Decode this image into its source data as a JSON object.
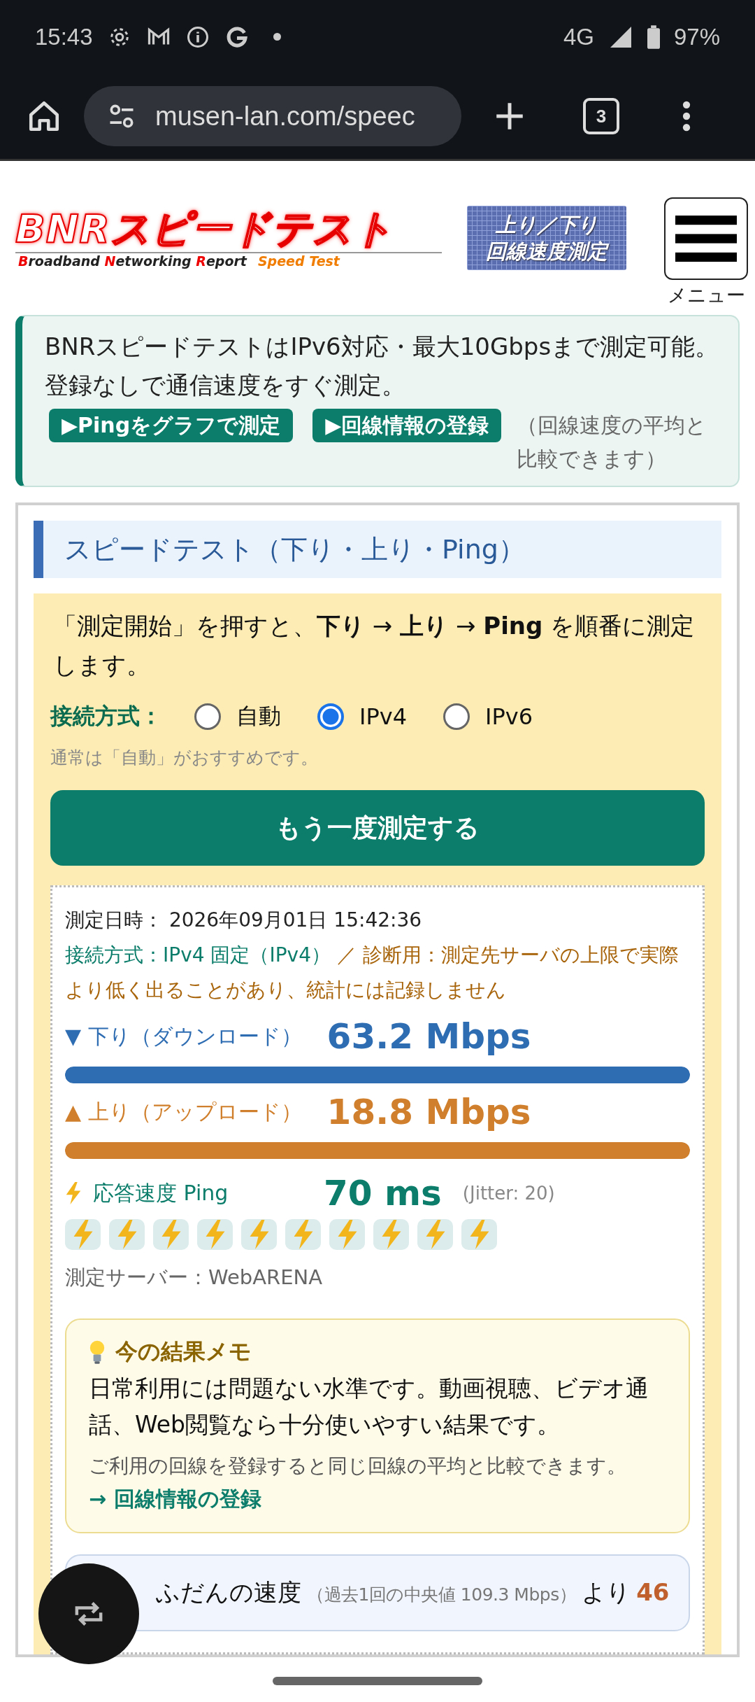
{
  "status_bar": {
    "time": "15:43",
    "network": "4G",
    "battery": "97%"
  },
  "browser": {
    "url": "musen-lan.com/speec",
    "tab_count": "3"
  },
  "header": {
    "logo_title": "BNRスピードテスト",
    "logo_subtitle": "**B**roadband **N**etworking **R**eport",
    "logo_tagline": "Speed Test",
    "badge_lines": [
      "上り／下り",
      "回線速度測定"
    ],
    "menu_label": "メニュー"
  },
  "intro": {
    "text": "BNRスピードテストはIPv6対応・最大10Gbpsまで測定可能。登録なしで通信速度をすぐ測定。",
    "buttons": [
      "▶Pingをグラフで測定",
      "▶回線情報の登録"
    ],
    "note": "（回線速度の平均と比較できます）"
  },
  "speed_test": {
    "heading": "スピードテスト（下り・上り・Ping）",
    "instruction": "「測定開始」を押すと、**下り** → **上り** → **Ping** を順番に測定します。",
    "connection_label": "接続方式：",
    "options": [
      {
        "label": "自動",
        "selected": false
      },
      {
        "label": "IPv4",
        "selected": true
      },
      {
        "label": "IPv6",
        "selected": false
      }
    ],
    "hint": "通常は「自動」がおすすめです。",
    "button": "もう一度測定する",
    "result": {
      "date_label": "測定日時：",
      "date": "2026年09月01日 15:42:36",
      "connection": "接続方式：IPv4 固定（IPv4）",
      "diagnostic": "／ 診断用：測定先サーバの上限で実際より低く出ることがあり、統計には記録しません",
      "metrics": [
        {
          "kind": "bar",
          "label": "▼ 下り（ダウンロード）",
          "value": "63.2 Mbps",
          "color": "#2f6db3",
          "level": 1
        },
        {
          "kind": "bar",
          "label": "▲ 上り（アップロード）",
          "value": "18.8 Mbps",
          "color": "#d0802c",
          "level": 1
        },
        {
          "kind": "ping",
          "label": "応答速度 Ping",
          "value": "70 ms",
          "jitter": "(Jitter: 20)",
          "color": "#0b7d6a",
          "stars": 10
        }
      ],
      "server": "測定サーバー：WebARENA",
      "memo": {
        "title": "今の結果メモ",
        "text": "日常利用には問題ない水準です。動画視聴、ビデオ通話、Web閲覧なら十分使いやすい結果です。",
        "note": "ご利用の回線を登録すると同じ回線の平均と比較できます。",
        "link": "→ 回線情報の登録"
      },
      "usual": {
        "title": "ふだんの速度",
        "detail": "（過去1回の中央値 109.3 Mbps）",
        "suffix": "より",
        "value": "46"
      }
    }
  }
}
